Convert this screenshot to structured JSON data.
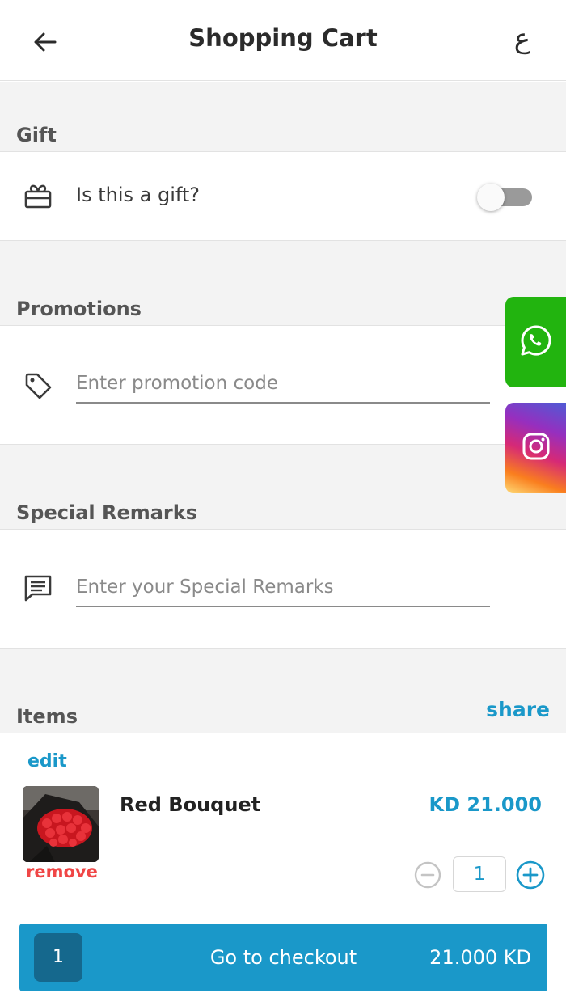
{
  "header": {
    "title": "Shopping Cart",
    "lang_toggle": "ع"
  },
  "gift": {
    "section_label": "Gift",
    "question": "Is this a gift?",
    "enabled": false
  },
  "promotions": {
    "section_label": "Promotions",
    "placeholder": "Enter promotion code",
    "value": ""
  },
  "remarks": {
    "section_label": "Special Remarks",
    "placeholder": "Enter your Special Remarks",
    "value": ""
  },
  "items": {
    "section_label": "Items",
    "share_label": "share",
    "list": [
      {
        "edit_label": "edit",
        "name": "Red Bouquet",
        "price": "KD 21.000",
        "remove_label": "remove",
        "quantity": "1"
      }
    ]
  },
  "checkout": {
    "count": "1",
    "label": "Go to checkout",
    "total": "21.000 KD"
  },
  "social": {
    "whatsapp_icon": "whatsapp-icon",
    "instagram_icon": "instagram-icon"
  },
  "colors": {
    "accent": "#1a98c9",
    "remove": "#f04646",
    "whatsapp": "#22b40f",
    "section_bg": "#f3f3f3"
  }
}
